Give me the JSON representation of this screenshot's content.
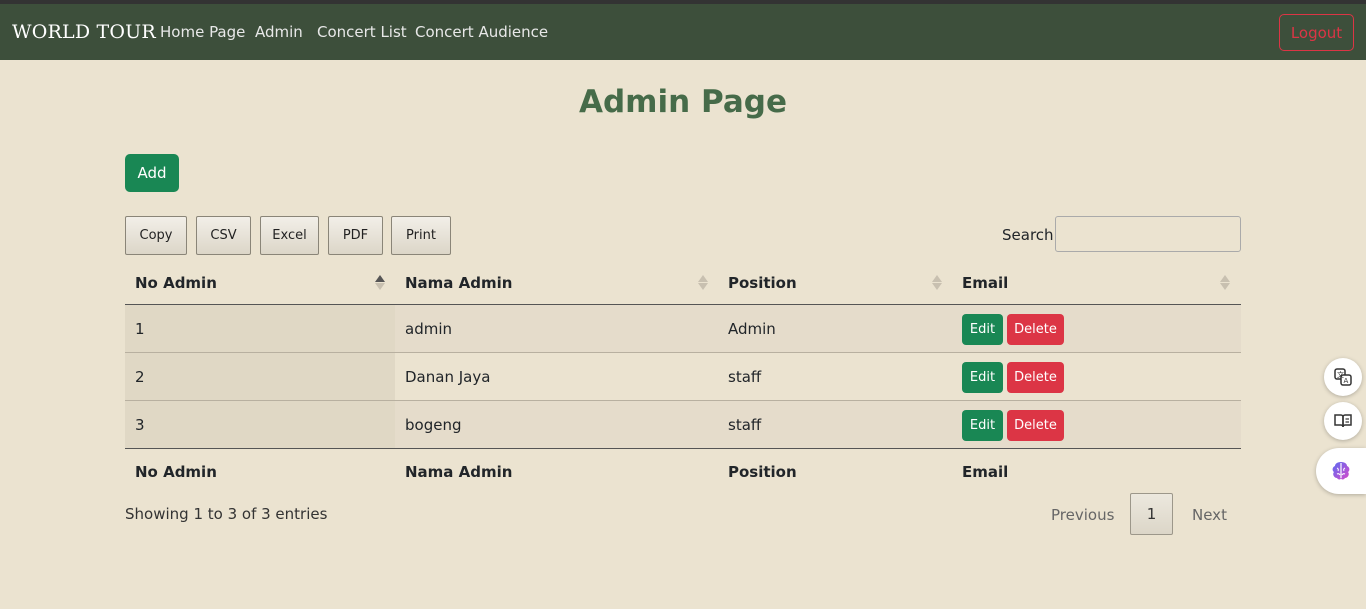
{
  "navbar": {
    "brand": "WORLD TOUR",
    "links": [
      "Home Page",
      "Admin",
      "Concert List",
      "Concert Audience"
    ],
    "logout": "Logout"
  },
  "page": {
    "title": "Admin Page",
    "add_label": "Add"
  },
  "toolbar": {
    "buttons": [
      "Copy",
      "CSV",
      "Excel",
      "PDF",
      "Print"
    ],
    "search_label": "Search:",
    "search_value": ""
  },
  "table": {
    "columns": [
      "No Admin",
      "Nama Admin",
      "Position",
      "Email"
    ],
    "rows": [
      {
        "no": "1",
        "nama": "admin",
        "position": "Admin"
      },
      {
        "no": "2",
        "nama": "Danan Jaya",
        "position": "staff"
      },
      {
        "no": "3",
        "nama": "bogeng",
        "position": "staff"
      }
    ],
    "edit_label": "Edit",
    "delete_label": "Delete"
  },
  "footer": {
    "info": "Showing 1 to 3 of 3 entries",
    "previous": "Previous",
    "page": "1",
    "next": "Next"
  },
  "side_widgets": [
    "translate-icon",
    "book-icon",
    "brain-icon"
  ],
  "colors": {
    "navbar": "#3d4f3b",
    "title": "#466b49",
    "success": "#198754",
    "danger": "#dc3545",
    "background": "#ebe3d0"
  }
}
